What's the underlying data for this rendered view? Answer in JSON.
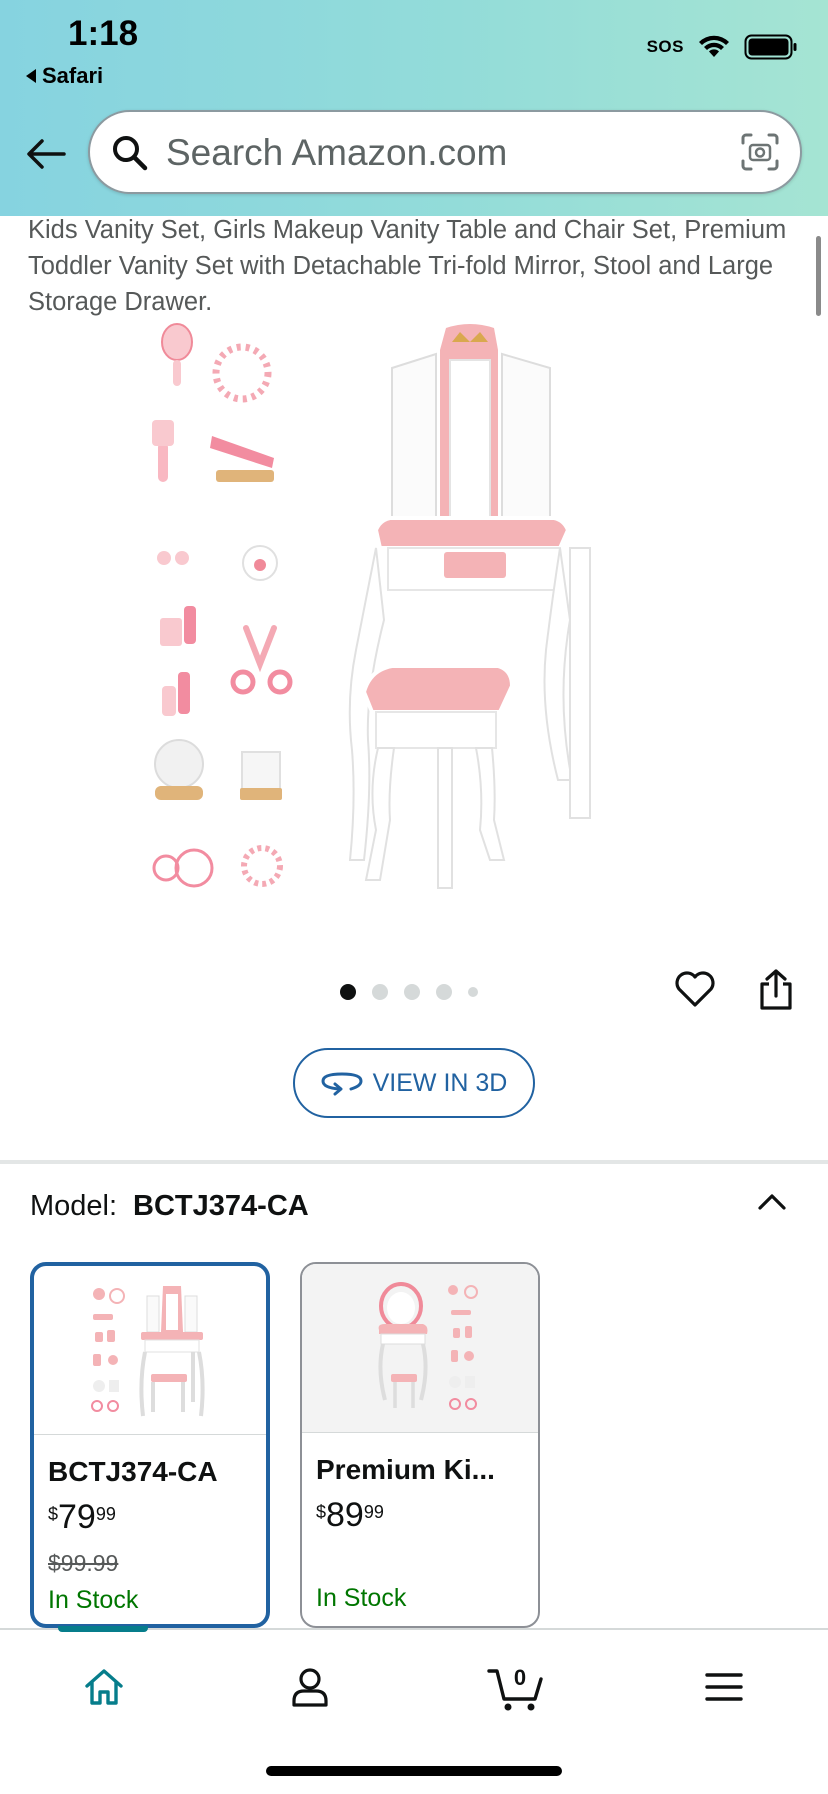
{
  "status_bar": {
    "time": "1:18",
    "back_app": "Safari",
    "sos": "SOS"
  },
  "search": {
    "placeholder": "Search Amazon.com"
  },
  "product": {
    "title": "Kids Vanity Set, Girls Makeup Vanity Table and Chair Set, Premium Toddler Vanity Set with Detachable Tri-fold Mirror, Stool and Large Storage Drawer.",
    "image_count": 5,
    "active_image_index": 0
  },
  "view3d": {
    "label": "VIEW IN 3D"
  },
  "model": {
    "label": "Model:",
    "value": "BCTJ374-CA",
    "options": [
      {
        "name": "BCTJ374-CA",
        "currency": "$",
        "price_whole": "79",
        "price_fraction": "99",
        "was_price": "$99.99",
        "stock": "In Stock",
        "selected": true
      },
      {
        "name": "Premium Ki...",
        "currency": "$",
        "price_whole": "89",
        "price_fraction": "99",
        "was_price": "",
        "stock": "In Stock",
        "selected": false
      }
    ]
  },
  "tabbar": {
    "cart_count": "0",
    "active": "home"
  },
  "colors": {
    "accent": "#2162a1",
    "in_stock": "#007600",
    "tab_active": "#067d8b",
    "header_start": "#86d3e0",
    "header_end": "#a5e4d3"
  }
}
